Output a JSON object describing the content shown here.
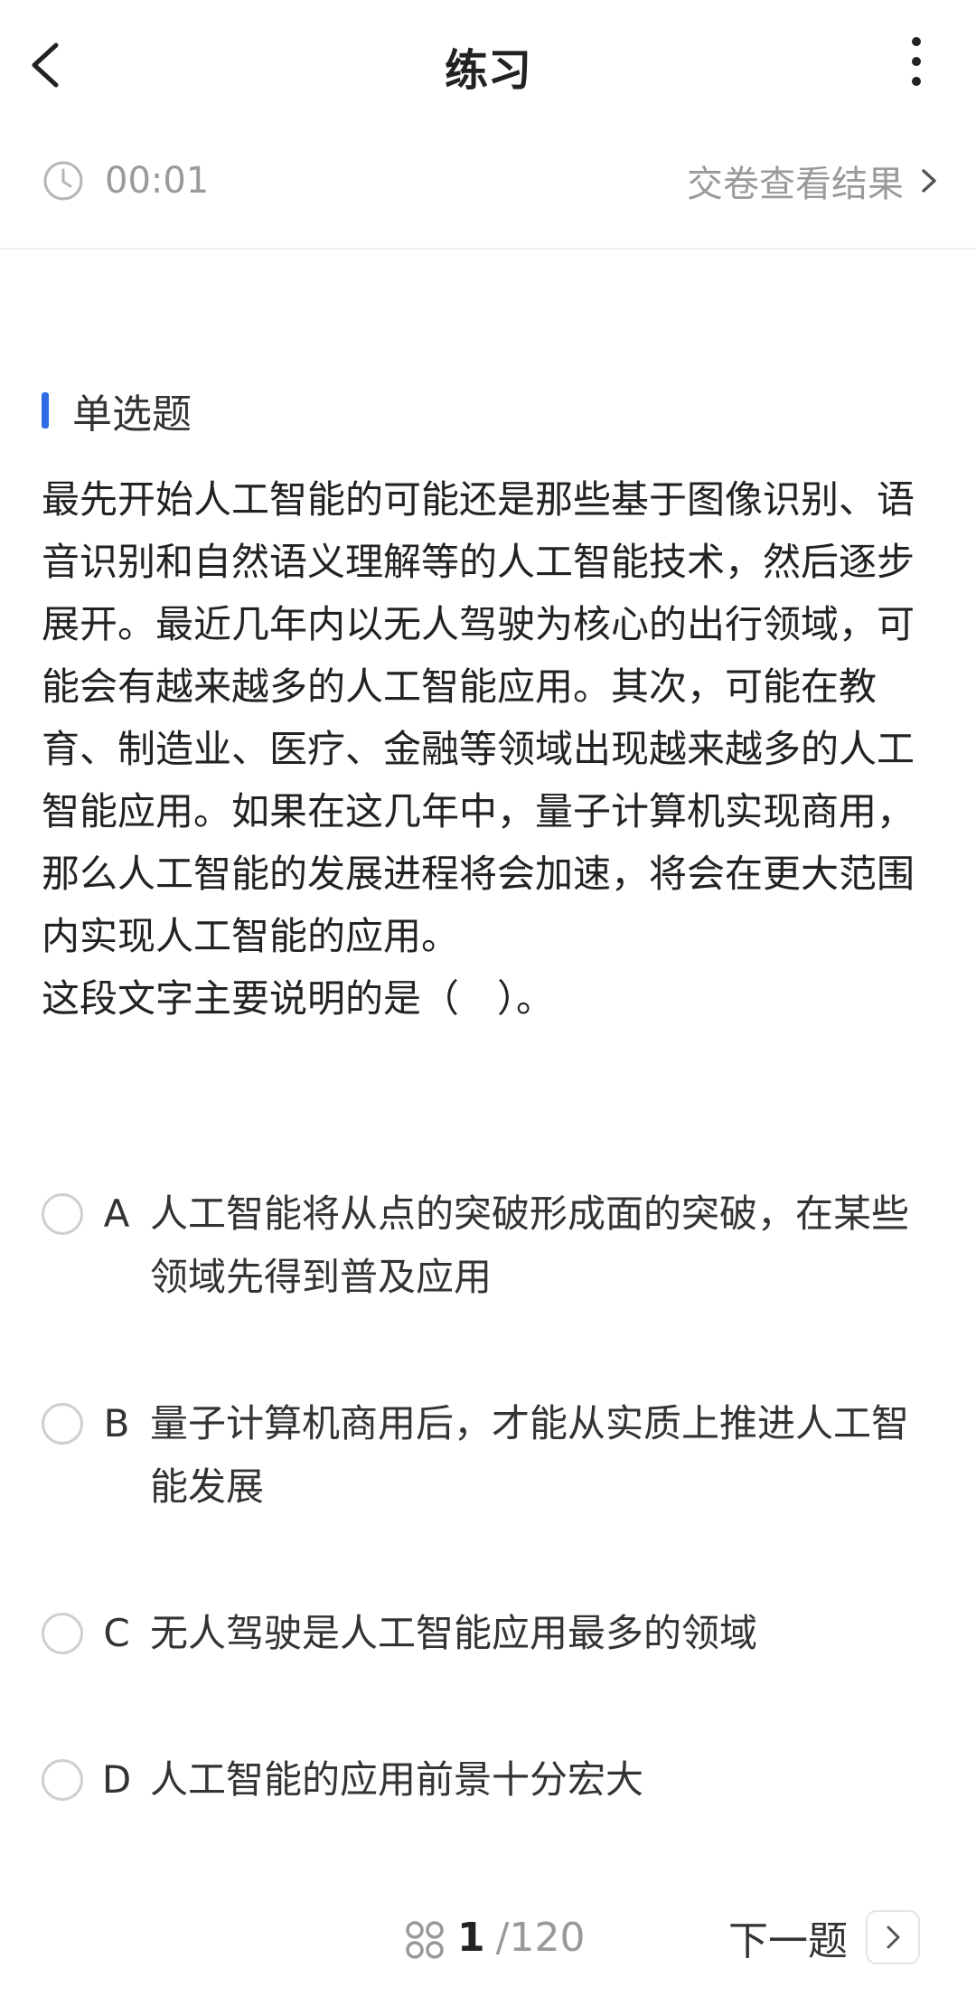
{
  "header": {
    "title": "练习",
    "back_icon": "chevron-left-icon",
    "more_icon": "more-vertical-icon"
  },
  "timer": {
    "icon": "clock-icon",
    "elapsed": "00:01",
    "submit_label": "交卷查看结果",
    "submit_icon": "chevron-right-icon"
  },
  "question": {
    "type_label": "单选题",
    "accent_color": "#2d6be4",
    "passage": "最先开始人工智能的可能还是那些基于图像识别、语音识别和自然语义理解等的人工智能技术，然后逐步展开。最近几年内以无人驾驶为核心的出行领域，可能会有越来越多的人工智能应用。其次，可能在教育、制造业、医疗、金融等领域出现越来越多的人工智能应用。如果在这几年中，量子计算机实现商用，那么人工智能的发展进程将会加速，将会在更大范围内实现人工智能的应用。",
    "prompt": "这段文字主要说明的是（　）。"
  },
  "options": [
    {
      "letter": "A",
      "text": "人工智能将从点的突破形成面的突破，在某些领域先得到普及应用"
    },
    {
      "letter": "B",
      "text": "量子计算机商用后，才能从实质上推进人工智能发展"
    },
    {
      "letter": "C",
      "text": "无人驾驶是人工智能应用最多的领域"
    },
    {
      "letter": "D",
      "text": "人工智能的应用前景十分宏大"
    }
  ],
  "footer": {
    "grid_icon": "grid-icon",
    "current_page": "1",
    "separator": "/",
    "total_pages": "120",
    "next_label": "下一题",
    "next_icon": "chevron-right-icon"
  }
}
